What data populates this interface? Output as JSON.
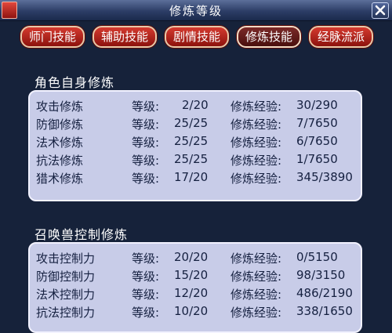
{
  "window": {
    "title": "修炼等级"
  },
  "tabs": [
    {
      "label": "师门技能",
      "active": false
    },
    {
      "label": "辅助技能",
      "active": false
    },
    {
      "label": "剧情技能",
      "active": false
    },
    {
      "label": "修炼技能",
      "active": true
    },
    {
      "label": "经脉流派",
      "active": false
    }
  ],
  "self_section": {
    "title": "角色自身修炼",
    "rows": [
      {
        "name": "攻击修炼",
        "level_label": "等级:",
        "level": "2/20",
        "exp_label": "修炼经验:",
        "exp": "30/290"
      },
      {
        "name": "防御修炼",
        "level_label": "等级:",
        "level": "25/25",
        "exp_label": "修炼经验:",
        "exp": "7/7650"
      },
      {
        "name": "法术修炼",
        "level_label": "等级:",
        "level": "25/25",
        "exp_label": "修炼经验:",
        "exp": "6/7650"
      },
      {
        "name": "抗法修炼",
        "level_label": "等级:",
        "level": "25/25",
        "exp_label": "修炼经验:",
        "exp": "1/7650"
      },
      {
        "name": "猎术修炼",
        "level_label": "等级:",
        "level": "17/20",
        "exp_label": "修炼经验:",
        "exp": "345/3890"
      }
    ]
  },
  "pet_section": {
    "title": "召唤兽控制修炼",
    "rows": [
      {
        "name": "攻击控制力",
        "level_label": "等级:",
        "level": "20/20",
        "exp_label": "修炼经验:",
        "exp": "0/5150"
      },
      {
        "name": "防御控制力",
        "level_label": "等级:",
        "level": "15/20",
        "exp_label": "修炼经验:",
        "exp": "98/3150"
      },
      {
        "name": "法术控制力",
        "level_label": "等级:",
        "level": "12/20",
        "exp_label": "修炼经验:",
        "exp": "486/2190"
      },
      {
        "name": "抗法控制力",
        "level_label": "等级:",
        "level": "10/20",
        "exp_label": "修炼经验:",
        "exp": "338/1650"
      }
    ]
  },
  "icons": {
    "title_icon": "app-icon",
    "close": "close-icon"
  },
  "colors": {
    "tab": "#c02a22",
    "panel": "#c8cce8",
    "background": "#16223a"
  }
}
